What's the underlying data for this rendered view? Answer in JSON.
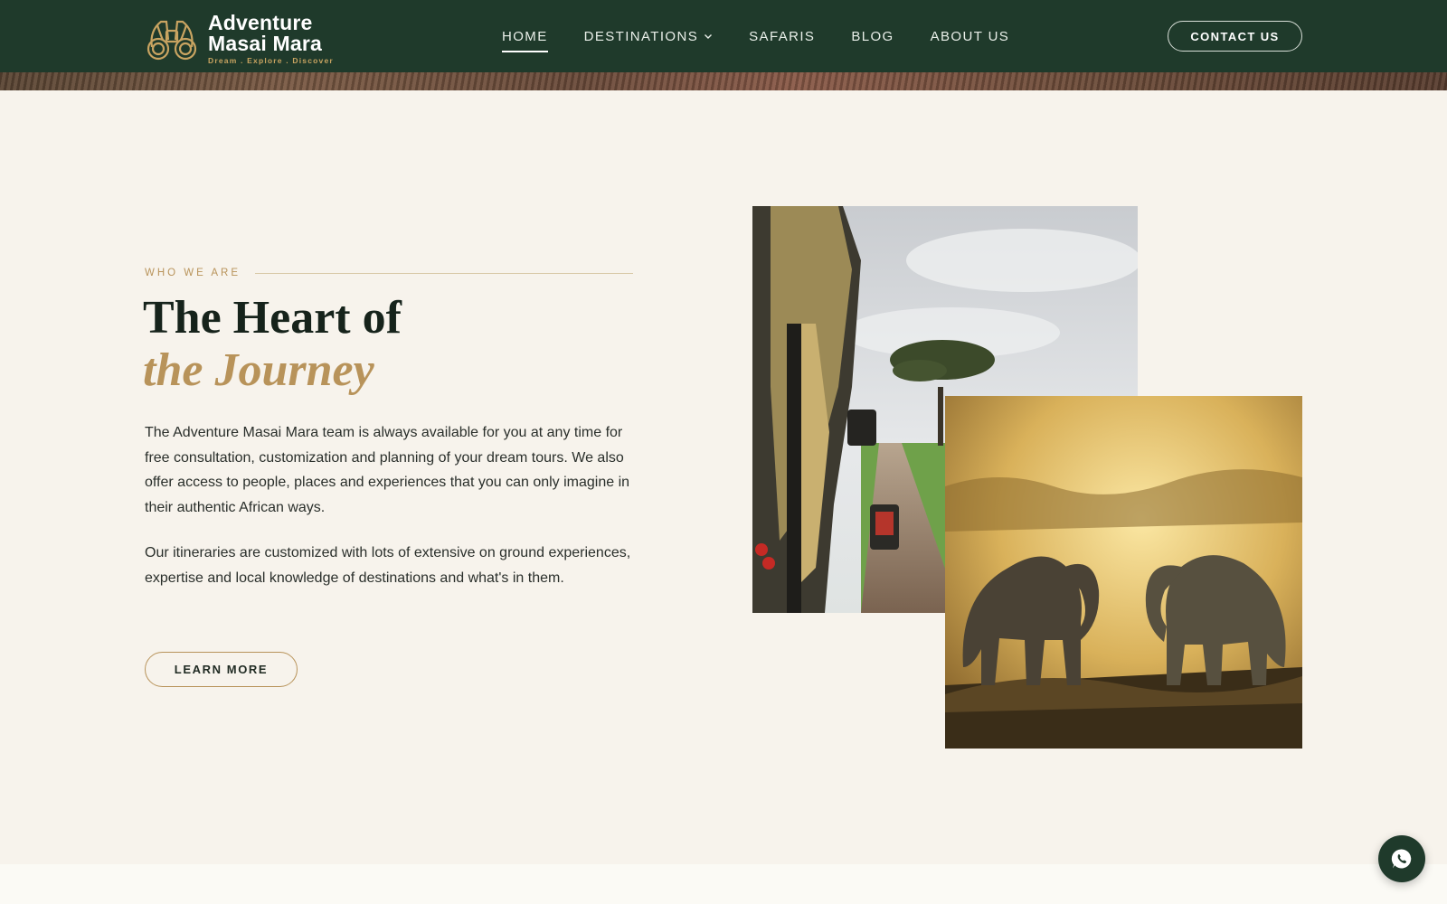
{
  "brand": {
    "line1": "Adventure",
    "line2": "Masai Mara",
    "tagline": "Dream . Explore . Discover",
    "logo_icon": "binoculars-icon",
    "accent_color": "#c9a461",
    "header_color": "#1f3a2b"
  },
  "nav": {
    "items": [
      {
        "label": "HOME",
        "active": true
      },
      {
        "label": "DESTINATIONS",
        "has_dropdown": true
      },
      {
        "label": "SAFARIS"
      },
      {
        "label": "BLOG"
      },
      {
        "label": "ABOUT US"
      }
    ],
    "contact_label": "CONTACT US"
  },
  "about": {
    "eyebrow": "WHO WE ARE",
    "heading_line1": "The Heart of",
    "heading_line2": "the Journey",
    "paragraph1": "The Adventure Masai Mara team is always available for you at any time for free consultation, customization and planning of your dream tours. We also offer access to people, places and experiences that you can only imagine in their authentic African ways.",
    "paragraph2": "Our itineraries are customized with lots of extensive on ground experiences, expertise and local knowledge of destinations and what's in them.",
    "button_label": "LEARN MORE"
  },
  "floating": {
    "whatsapp_icon": "whatsapp-icon"
  }
}
